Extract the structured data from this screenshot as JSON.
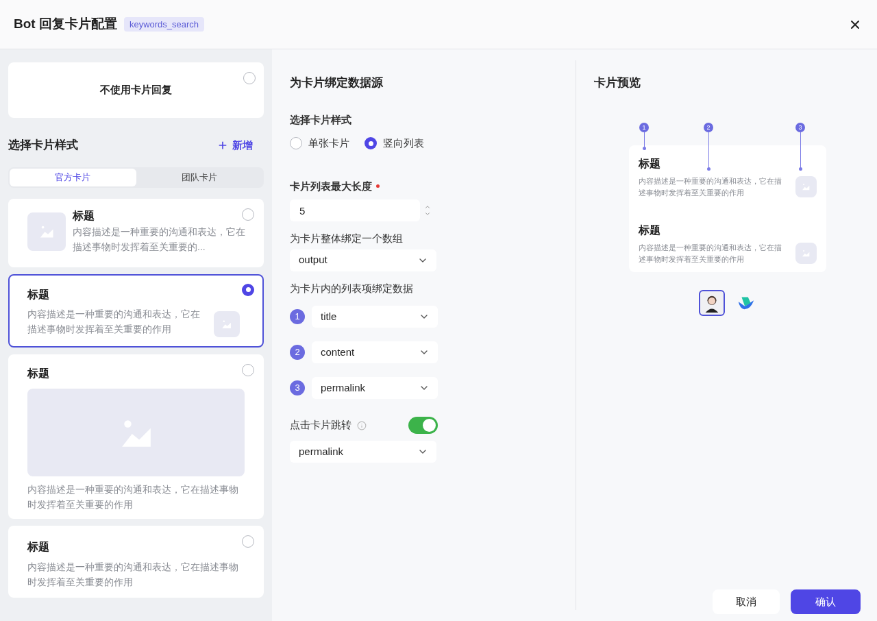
{
  "dialog": {
    "title": "Bot 回复卡片配置",
    "tag": "keywords_search"
  },
  "left": {
    "no_card": {
      "label": "不使用卡片回复",
      "selected": false
    },
    "section_title": "选择卡片样式",
    "add_label": "新增",
    "tabs": [
      {
        "label": "官方卡片",
        "selected": true
      },
      {
        "label": "团队卡片",
        "selected": false
      }
    ],
    "cards": [
      {
        "kind": "thumb_left",
        "title": "标题",
        "description": "内容描述是一种重要的沟通和表达，它在描述事物时发挥着至关重要的...",
        "selected": false
      },
      {
        "kind": "thumb_right",
        "title": "标题",
        "description": "内容描述是一种重要的沟通和表达，它在描述事物时发挥着至关重要的作用",
        "selected": true
      },
      {
        "kind": "banner",
        "title": "标题",
        "description": "内容描述是一种重要的沟通和表达，它在描述事物时发挥着至关重要的作用",
        "selected": false
      },
      {
        "kind": "text",
        "title": "标题",
        "description": "内容描述是一种重要的沟通和表达，它在描述事物时发挥着至关重要的作用",
        "selected": false
      }
    ]
  },
  "binding": {
    "title": "为卡片绑定数据源",
    "style_label": "选择卡片样式",
    "style_options": [
      {
        "label": "单张卡片",
        "selected": false
      },
      {
        "label": "竖向列表",
        "selected": true
      }
    ],
    "max_length": {
      "label": "卡片列表最大长度",
      "required": true,
      "value": "5"
    },
    "array_binding": {
      "label": "为卡片整体绑定一个数组",
      "value": "output"
    },
    "item_binding": {
      "label": "为卡片内的列表项绑定数据",
      "fields": [
        {
          "number": "1",
          "value": "title"
        },
        {
          "number": "2",
          "value": "content"
        },
        {
          "number": "3",
          "value": "permalink"
        }
      ]
    },
    "jump": {
      "label": "点击卡片跳转",
      "on": true,
      "value": "permalink"
    }
  },
  "preview": {
    "title": "卡片预览",
    "markers": [
      "1",
      "2",
      "3"
    ],
    "items": [
      {
        "title": "标题",
        "description": "内容描述是一种重要的沟通和表达，它在描述事物时发挥着至关重要的作用"
      },
      {
        "title": "标题",
        "description": "内容描述是一种重要的沟通和表达，它在描述事物时发挥着至关重要的作用"
      }
    ],
    "avatars": [
      {
        "kind": "person",
        "selected": true
      },
      {
        "kind": "logo",
        "selected": false
      }
    ]
  },
  "footer": {
    "cancel": "取消",
    "confirm": "确认"
  }
}
